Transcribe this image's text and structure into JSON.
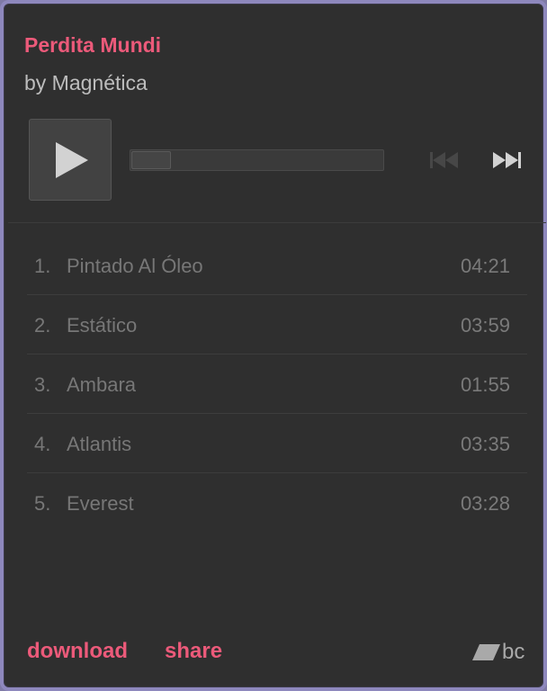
{
  "album": {
    "title": "Perdita Mundi",
    "artist": "by Magnética"
  },
  "player": {
    "play_icon": "play-icon",
    "prev_icon": "previous-track-icon",
    "next_icon": "next-track-icon",
    "progress": 0
  },
  "tracks": [
    {
      "num": "1.",
      "title": "Pintado Al Óleo",
      "duration": "04:21"
    },
    {
      "num": "2.",
      "title": "Estático",
      "duration": "03:59"
    },
    {
      "num": "3.",
      "title": "Ambara",
      "duration": "01:55"
    },
    {
      "num": "4.",
      "title": "Atlantis",
      "duration": "03:35"
    },
    {
      "num": "5.",
      "title": "Everest",
      "duration": "03:28"
    }
  ],
  "footer": {
    "download_label": "download",
    "share_label": "share",
    "logo_text": "bc"
  },
  "colors": {
    "accent": "#ec5a7a",
    "background": "#2f2f2f",
    "border": "#8e88bd"
  }
}
